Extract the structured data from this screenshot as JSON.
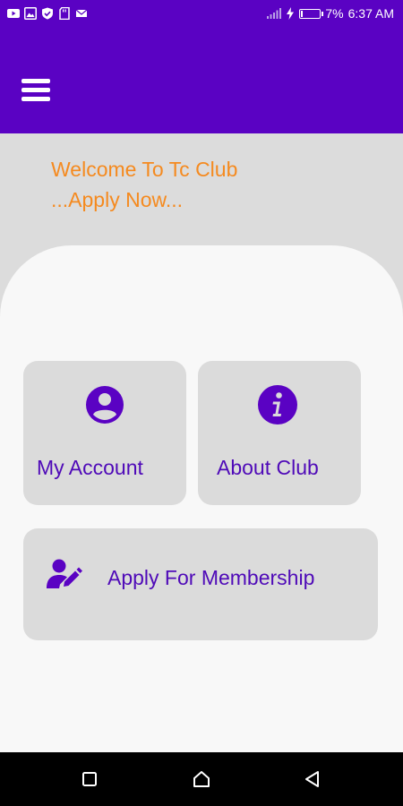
{
  "status_bar": {
    "battery_percent": "7%",
    "time": "6:37 AM",
    "left_icons": [
      "youtube-icon",
      "gallery-icon",
      "shield-icon",
      "sd-card-icon",
      "mail-icon"
    ],
    "right_icons": [
      "signal-icon",
      "charging-icon",
      "battery-icon"
    ]
  },
  "app_bar": {
    "menu_icon": "hamburger-menu-icon"
  },
  "welcome": {
    "line1": "Welcome To Tc Club",
    "line2": "...Apply Now..."
  },
  "tiles": {
    "my_account": {
      "label": "My Account",
      "icon": "account-circle-icon"
    },
    "about_club": {
      "label": "About Club",
      "icon": "info-icon"
    },
    "apply": {
      "label": "Apply For Membership",
      "icon": "user-edit-icon"
    }
  },
  "nav_bar": {
    "buttons": [
      "recents-square-icon",
      "home-icon",
      "back-triangle-icon"
    ]
  },
  "colors": {
    "primary": "#5a02c3",
    "accent_text": "#f58a1f",
    "tile_text": "#4f0ab8",
    "tile_bg": "#dbdbdb",
    "card_bg": "#f8f8f8",
    "page_bg": "#dcdcdc"
  }
}
